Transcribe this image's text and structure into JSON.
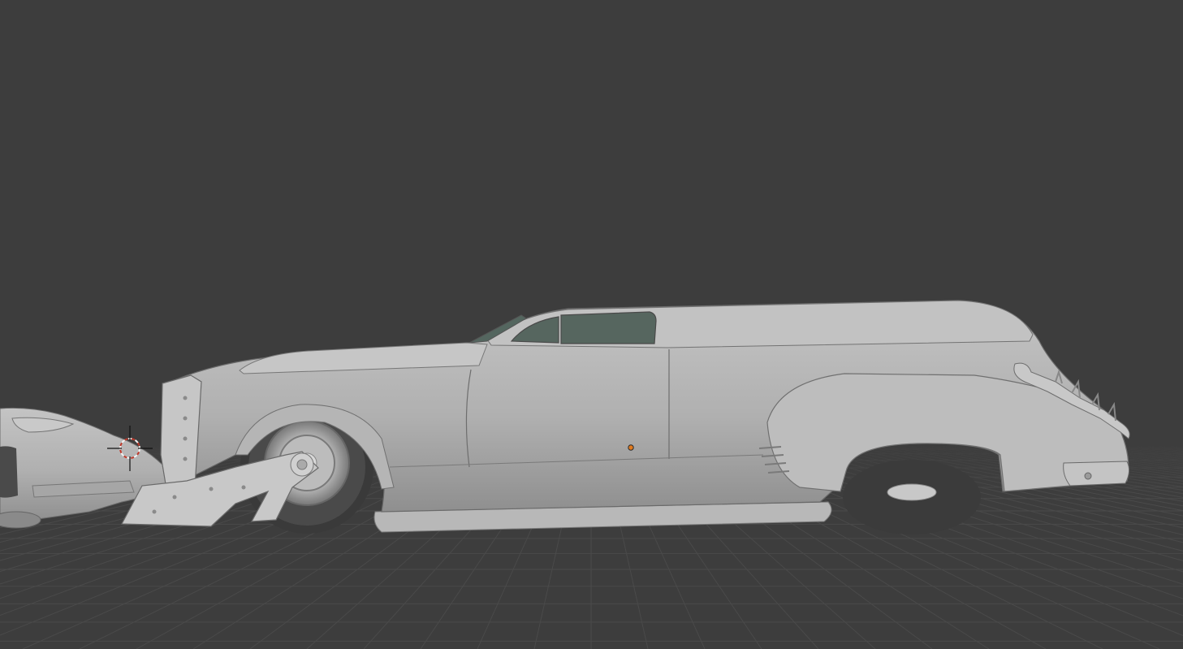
{
  "viewport": {
    "background_color": "#3d3d3d",
    "grid_color": "#4a4a4a",
    "grid_axis_color": "#5a4646",
    "model_color": "#b4b4b4",
    "model_shadow_color": "#8e8e8e",
    "glass_color": "#54665f",
    "tire_color": "#3a3a3a",
    "origin_marker_color": "#e07a1f",
    "cursor_ring_colors": [
      "#c0392b",
      "#f2f2f2"
    ]
  },
  "icons": {
    "cursor": "3d-cursor-icon",
    "origin": "object-origin-dot-icon"
  }
}
